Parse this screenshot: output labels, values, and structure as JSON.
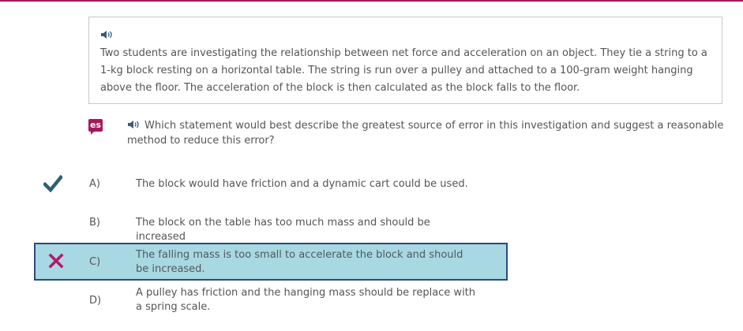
{
  "passage": {
    "text": "Two students are investigating the relationship between net force and acceleration on an object. They tie a string to a 1-kg block resting on a horizontal table. The string is run over a pulley and attached to a 100-gram weight hanging above the floor. The acceleration of the block is then calculated as the block falls to the floor."
  },
  "badge": {
    "label": "es"
  },
  "question": {
    "text": "Which statement would best describe the greatest source of error in this investigation and suggest a reasonable method to reduce this error?"
  },
  "choices": [
    {
      "letter": "A)",
      "text": "The block would have friction and a dynamic cart could be used.",
      "status": "correct"
    },
    {
      "letter": "B)",
      "text": "The block on the table has too much mass and should be increased",
      "status": "none"
    },
    {
      "letter": "C)",
      "text": "The falling mass is too small to accelerate the block and should be increased.",
      "status": "selected-incorrect"
    },
    {
      "letter": "D)",
      "text": "A pulley has friction and the hanging mass should be replace with a spring scale.",
      "status": "none"
    }
  ],
  "colors": {
    "accent": "#a3195b",
    "correct_check": "#2e6070",
    "selected_bg": "#a8d8e2",
    "selected_border": "#2a4a7d",
    "incorrect_x": "#b5176b"
  },
  "icons": [
    "speaker-icon",
    "checkmark-icon",
    "x-icon"
  ]
}
